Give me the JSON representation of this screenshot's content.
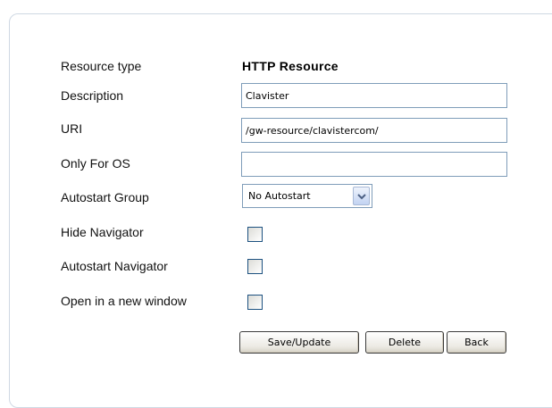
{
  "form": {
    "resource_type_label": "Resource type",
    "resource_type_value": "HTTP Resource",
    "description_label": "Description",
    "description_value": "Clavister",
    "uri_label": "URI",
    "uri_value": "/gw-resource/clavistercom/",
    "only_for_os_label": "Only For OS",
    "only_for_os_value": "",
    "autostart_group_label": "Autostart Group",
    "autostart_group_value": "No Autostart",
    "hide_navigator_label": "Hide Navigator",
    "hide_navigator_checked": false,
    "autostart_navigator_label": "Autostart Navigator",
    "autostart_navigator_checked": false,
    "open_new_window_label": "Open in a new window",
    "open_new_window_checked": false
  },
  "buttons": {
    "save_label": "Save/Update",
    "delete_label": "Delete",
    "back_label": "Back"
  },
  "icons": {
    "select_arrow": "chevron-down-icon"
  },
  "colors": {
    "panel_border": "#cfd8e3",
    "input_border": "#7f9db9",
    "checkbox_border": "#1c5180"
  }
}
